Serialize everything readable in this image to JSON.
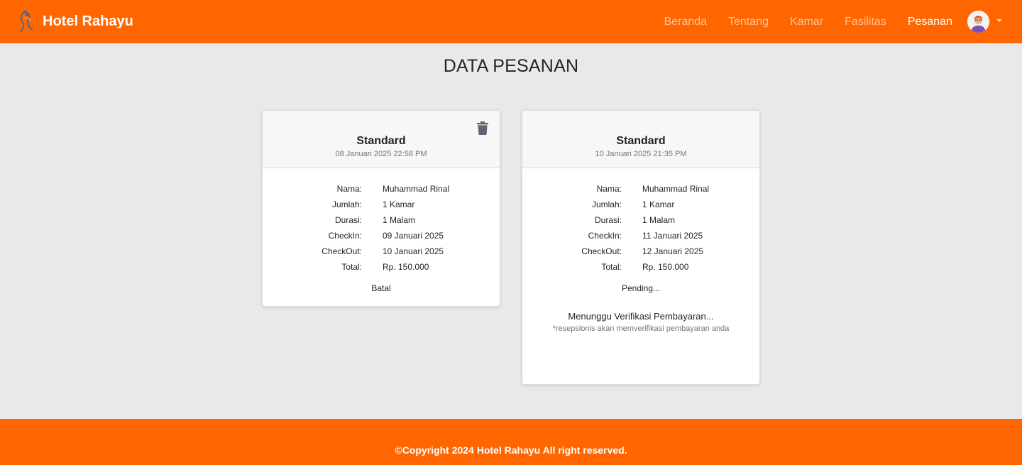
{
  "navbar": {
    "brand": "Hotel Rahayu",
    "links": [
      {
        "label": "Beranda"
      },
      {
        "label": "Tentang"
      },
      {
        "label": "Kamar"
      },
      {
        "label": "Fasilitas"
      },
      {
        "label": "Pesanan",
        "active": true
      }
    ]
  },
  "page": {
    "title": "DATA PESANAN"
  },
  "orders": [
    {
      "room_type": "Standard",
      "date": "08 Januari 2025  22:58 PM",
      "fields": [
        {
          "label": "Nama:",
          "value": "Muhammad Rinal"
        },
        {
          "label": "Jumlah:",
          "value": "1 Kamar"
        },
        {
          "label": "Durasi:",
          "value": "1 Malam"
        },
        {
          "label": "CheckIn:",
          "value": "09 Januari 2025"
        },
        {
          "label": "CheckOut:",
          "value": "10 Januari 2025"
        },
        {
          "label": "Total:",
          "value": "Rp. 150.000"
        }
      ],
      "status": "Batal"
    },
    {
      "room_type": "Standard",
      "date": "10 Januari 2025  21:35 PM",
      "fields": [
        {
          "label": "Nama:",
          "value": "Muhammad Rinal"
        },
        {
          "label": "Jumlah:",
          "value": "1 Kamar"
        },
        {
          "label": "Durasi:",
          "value": "1 Malam"
        },
        {
          "label": "CheckIn:",
          "value": "11 Januari 2025"
        },
        {
          "label": "CheckOut:",
          "value": "12 Januari 2025"
        },
        {
          "label": "Total:",
          "value": "Rp. 150.000"
        }
      ],
      "status": "Pending...",
      "verification_title": "Menunggu Verifikasi Pembayaran...",
      "verification_note": "*resepsionis akan memverifikasi pembayaran anda"
    }
  ],
  "footer": {
    "text": "©Copyright 2024 Hotel Rahayu All right reserved."
  },
  "colors": {
    "brand_orange": "#ff6600",
    "page_bg": "#e9e9e9"
  },
  "icons": {
    "logo": "hotel-logo-icon",
    "user": "user-avatar-icon",
    "dropdown": "caret-down-icon",
    "delete": "trash-icon"
  }
}
